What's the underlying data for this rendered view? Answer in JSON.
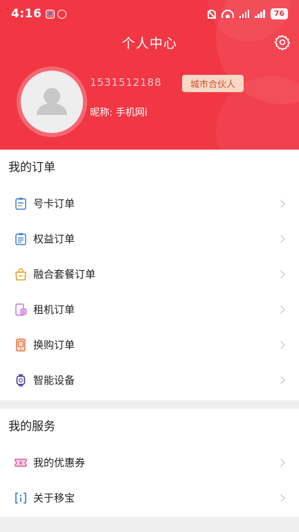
{
  "status": {
    "time": "4:16",
    "battery": "76"
  },
  "header": {
    "title": "个人中心"
  },
  "profile": {
    "phone": "1531512188",
    "badge": "城市合伙人",
    "nickname": "昵称: 手机网i"
  },
  "orders": {
    "title": "我的订单",
    "items": [
      {
        "label": "号卡订单",
        "icon": "clipboard-icon"
      },
      {
        "label": "权益订单",
        "icon": "document-list-icon"
      },
      {
        "label": "融合套餐订单",
        "icon": "shopping-bag-icon"
      },
      {
        "label": "租机订单",
        "icon": "phone-rent-icon"
      },
      {
        "label": "换购订单",
        "icon": "phone-exchange-icon"
      },
      {
        "label": "智能设备",
        "icon": "smartwatch-icon"
      }
    ]
  },
  "services": {
    "title": "我的服务",
    "items": [
      {
        "label": "我的优惠券",
        "icon": "coupon-icon"
      },
      {
        "label": "关于移宝",
        "icon": "info-icon"
      }
    ]
  },
  "colors": {
    "primary": "#f13644",
    "badge_bg": "#fbd8c6",
    "badge_text": "#c4542f"
  }
}
